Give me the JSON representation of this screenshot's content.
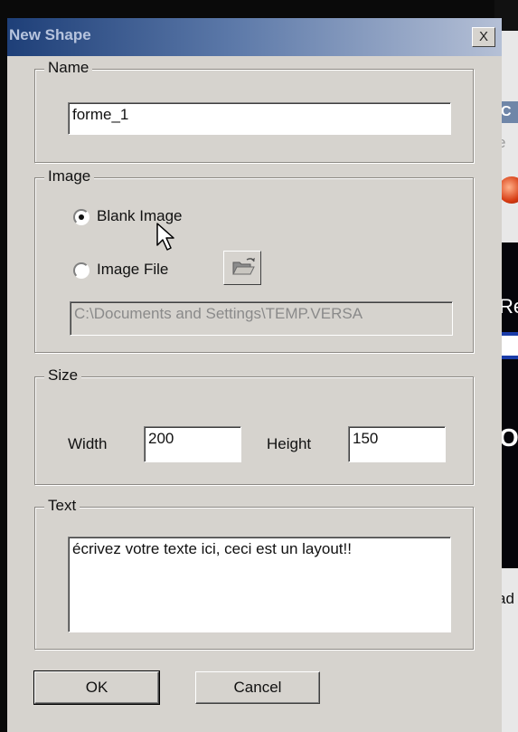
{
  "dialog": {
    "title": "New Shape",
    "close_glyph": "X"
  },
  "name_group": {
    "legend": "Name",
    "value": "forme_1"
  },
  "image_group": {
    "legend": "Image",
    "blank_label": "Blank Image",
    "file_label": "Image File",
    "selected": "blank",
    "path_value": "C:\\Documents and Settings\\TEMP.VERSA",
    "browse_icon": "open-folder-icon"
  },
  "size_group": {
    "legend": "Size",
    "width_label": "Width",
    "width_value": "200",
    "height_label": "Height",
    "height_value": "150"
  },
  "text_group": {
    "legend": "Text",
    "value": "écrivez votre texte ici, ceci est un layout!!"
  },
  "buttons": {
    "ok": "OK",
    "cancel": "Cancel"
  },
  "background": {
    "c": "C",
    "e": "e",
    "re": "Re",
    "o": "O",
    "ad": "ad"
  },
  "colors": {
    "title_gradient_start": "#1e3f78",
    "dialog_face": "#d6d3ce"
  }
}
